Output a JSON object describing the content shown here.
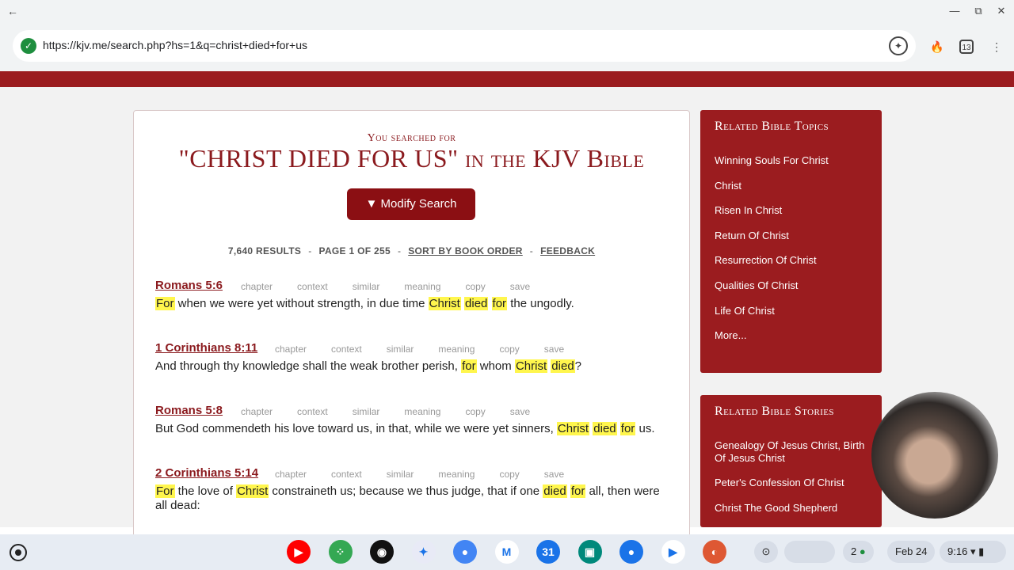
{
  "browser": {
    "url": "https://kjv.me/search.php?hs=1&q=christ+died+for+us",
    "tab_count": "13",
    "icons": [
      "back-arrow-icon",
      "minimize-icon",
      "restore-icon",
      "close-icon",
      "site-shield-icon",
      "ai-assist-icon",
      "fire-icon",
      "more-vert-icon"
    ]
  },
  "header": {
    "searched_for": "You searched for",
    "title": "\"CHRIST DIED FOR US\" in the KJV Bible",
    "modify_button": "▼ Modify Search"
  },
  "results": {
    "count": "7,640 RESULTS",
    "sep1": "-",
    "page": "PAGE 1 OF 255",
    "sep2": "-",
    "sort": "SORT BY BOOK ORDER",
    "sep3": "-",
    "feedback": "FEEDBACK"
  },
  "verse_tools": [
    "chapter",
    "context",
    "similar",
    "meaning",
    "copy",
    "save"
  ],
  "verses": [
    {
      "ref": "Romans 5:6",
      "segments": [
        {
          "t": "For",
          "hl": true
        },
        {
          "t": " when we were yet without strength, in due time ",
          "hl": false
        },
        {
          "t": "Christ",
          "hl": true
        },
        {
          "t": " ",
          "hl": false
        },
        {
          "t": "died",
          "hl": true
        },
        {
          "t": " ",
          "hl": false
        },
        {
          "t": "for",
          "hl": true
        },
        {
          "t": " the ungodly.",
          "hl": false
        }
      ]
    },
    {
      "ref": "1 Corinthians 8:11",
      "segments": [
        {
          "t": "And through thy knowledge shall the weak brother perish, ",
          "hl": false
        },
        {
          "t": "for",
          "hl": true
        },
        {
          "t": " whom ",
          "hl": false
        },
        {
          "t": "Christ",
          "hl": true
        },
        {
          "t": " ",
          "hl": false
        },
        {
          "t": "died",
          "hl": true
        },
        {
          "t": "?",
          "hl": false
        }
      ]
    },
    {
      "ref": "Romans 5:8",
      "segments": [
        {
          "t": "But God commendeth his love toward us, in that, while we were yet sinners, ",
          "hl": false
        },
        {
          "t": "Christ",
          "hl": true
        },
        {
          "t": " ",
          "hl": false
        },
        {
          "t": "died",
          "hl": true
        },
        {
          "t": " ",
          "hl": false
        },
        {
          "t": "for",
          "hl": true
        },
        {
          "t": " us.",
          "hl": false
        }
      ]
    },
    {
      "ref": "2 Corinthians 5:14",
      "segments": [
        {
          "t": "For",
          "hl": true
        },
        {
          "t": " the love of ",
          "hl": false
        },
        {
          "t": "Christ",
          "hl": true
        },
        {
          "t": " constraineth us; because we thus judge, that if one ",
          "hl": false
        },
        {
          "t": "died",
          "hl": true
        },
        {
          "t": " ",
          "hl": false
        },
        {
          "t": "for",
          "hl": true
        },
        {
          "t": " all, then were all dead:",
          "hl": false
        }
      ]
    }
  ],
  "sidebar": {
    "topics_title": "Related Bible Topics",
    "topics": [
      "Winning Souls For Christ",
      "Christ",
      "Risen In Christ",
      "Return Of Christ",
      "Resurrection Of Christ",
      "Qualities Of Christ",
      "Life Of Christ",
      "More..."
    ],
    "stories_title": "Related Bible Stories",
    "stories": [
      "Genealogy Of Jesus Christ, Birth Of Jesus Christ",
      "Peter's Confession Of Christ",
      "Christ The Good Shepherd"
    ]
  },
  "shelf": {
    "apps": [
      {
        "name": "youtube-icon",
        "color": "#ff0000",
        "glyph": "▶"
      },
      {
        "name": "app-grid-icon",
        "color": "#34a853",
        "glyph": "⁘"
      },
      {
        "name": "podcast-icon",
        "color": "#111111",
        "glyph": "◉"
      },
      {
        "name": "gemini-icon",
        "color": "#e8eaf6",
        "glyph": "✦"
      },
      {
        "name": "chrome-icon",
        "color": "#4285f4",
        "glyph": "●"
      },
      {
        "name": "gmail-icon",
        "color": "#ffffff",
        "glyph": "M"
      },
      {
        "name": "calendar-icon",
        "color": "#1a73e8",
        "glyph": "31"
      },
      {
        "name": "meet-icon",
        "color": "#00897b",
        "glyph": "▣"
      },
      {
        "name": "messages-icon",
        "color": "#1a73e8",
        "glyph": "●"
      },
      {
        "name": "play-store-icon",
        "color": "#ffffff",
        "glyph": "▶"
      },
      {
        "name": "duckduckgo-icon",
        "color": "#de5833",
        "glyph": "◐"
      }
    ],
    "notifications": "2",
    "date": "Feb 24",
    "time": "9:16"
  }
}
